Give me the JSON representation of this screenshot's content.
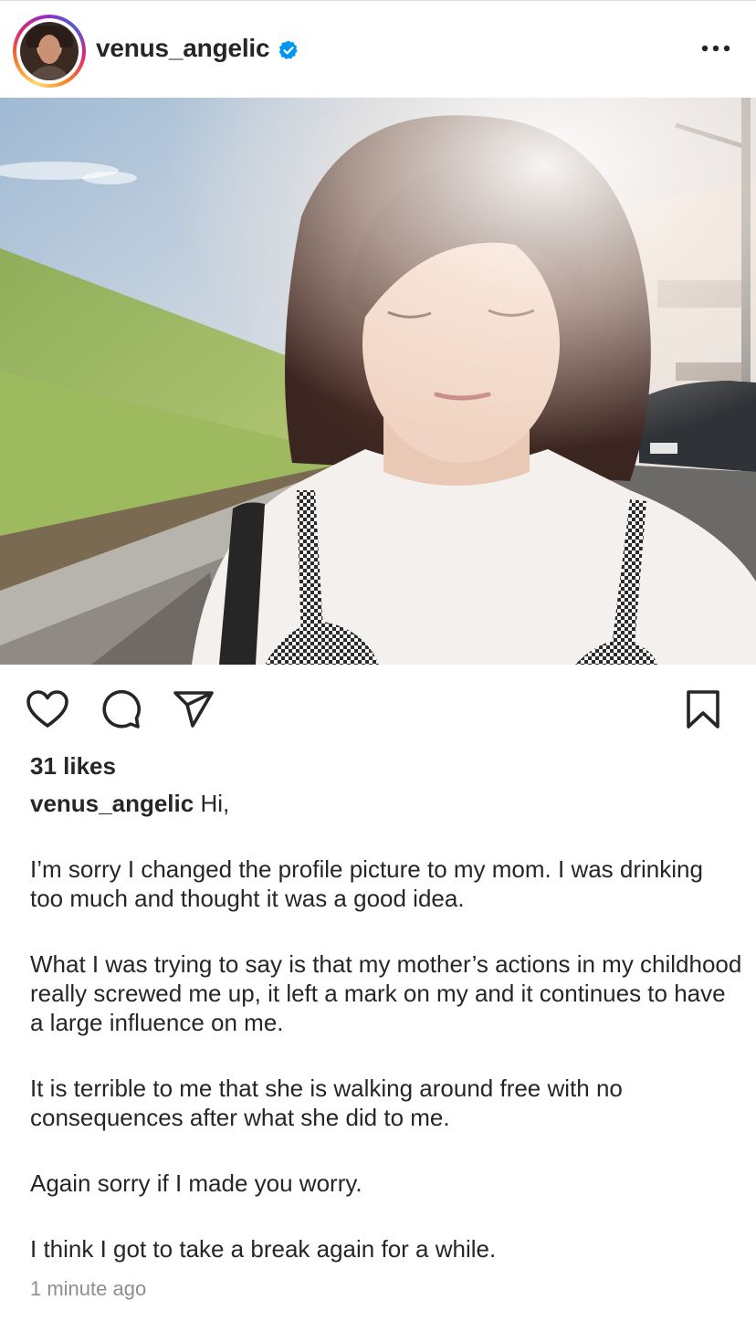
{
  "post": {
    "username": "venus_angelic",
    "verified": true,
    "likes": "31 likes",
    "caption_user": "venus_angelic",
    "caption_first": "Hi,",
    "paragraphs": [
      "I’m sorry I changed the profile picture to my mom. I was drinking too much and thought it was a good idea.",
      "What I was trying to say is that my mother’s actions in my childhood really screwed me up, it left a mark on my and it continues to have a large influence on me.",
      "It is terrible to me that she is walking around free with no consequences after what she did to me.",
      "Again sorry if I made you worry.",
      "I think I got to take a break again for a while."
    ],
    "timestamp": "1 minute ago"
  },
  "icons": {
    "verified": "verified-badge-icon",
    "more": "more-options-icon",
    "like": "heart-icon",
    "comment": "comment-icon",
    "share": "share-icon",
    "save": "bookmark-icon"
  },
  "colors": {
    "text": "#262626",
    "muted": "#8e8e8e",
    "verified": "#0095f6",
    "divider": "#dbdbdb"
  }
}
